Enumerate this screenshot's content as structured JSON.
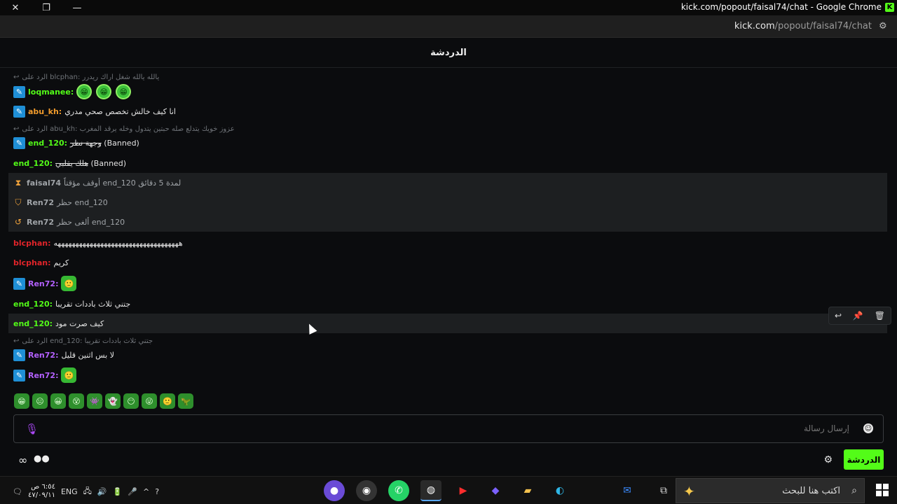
{
  "window": {
    "title": "kick.com/popout/faisal74/chat - Google Chrome",
    "close_icon": "close-icon",
    "restore_icon": "restore-icon",
    "minimize_icon": "minimize-icon"
  },
  "url": {
    "domain": "kick.com",
    "path": "/popout/faisal74/chat"
  },
  "header": {
    "title": "الدردشة"
  },
  "messages": [
    {
      "type": "reply",
      "text": "الرد على blcphan: يالله يالله شغل اراك ريدرر"
    },
    {
      "type": "chat",
      "user": "loqmanee",
      "color": "green",
      "badge": true,
      "text": "",
      "emotes": [
        "😁",
        "😁",
        "😁"
      ]
    },
    {
      "type": "chat",
      "user": "abu_kh",
      "color": "orange",
      "badge": true,
      "text": "انا كيف خالش تخصص صحي مدري"
    },
    {
      "type": "reply",
      "text": "الرد على abu_kh: عزوز خويك يتدلع صله حبتين يتدول وخله يرقد المغرب"
    },
    {
      "type": "chat",
      "user": "end_120",
      "color": "green",
      "badge": true,
      "text": "وجهة نظر",
      "banned": "(Banned)"
    },
    {
      "type": "chat",
      "user": "end_120",
      "color": "green",
      "badge": false,
      "text": "هلك يقلبي",
      "banned": "(Banned)"
    },
    {
      "type": "mod",
      "user": "faisal74",
      "text": "أوقف مؤقتاً end_120 لمدة 5 دقائق"
    },
    {
      "type": "mod",
      "user": "Ren72",
      "text": "حظر end_120"
    },
    {
      "type": "mod",
      "user": "Ren72",
      "text": "ألغى حظر end_120"
    },
    {
      "type": "chat",
      "user": "blcphan",
      "color": "red",
      "badge": false,
      "text": "هههههههههههههههههههههههههههههههههههه"
    },
    {
      "type": "chat",
      "user": "blcphan",
      "color": "red",
      "badge": false,
      "text": "كريم"
    },
    {
      "type": "chat",
      "user": "Ren72",
      "color": "purple",
      "badge": true,
      "text": "",
      "emotes": [
        "🙂"
      ]
    },
    {
      "type": "chat",
      "user": "end_120",
      "color": "green",
      "badge": false,
      "text": "جتني ثلاث باددات تقريبا"
    },
    {
      "type": "chat",
      "user": "end_120",
      "color": "green",
      "badge": false,
      "text": "كيف صرت مود"
    },
    {
      "type": "reply",
      "text": "الرد على end_120: جتني ثلاث باددات تقريبا"
    },
    {
      "type": "chat",
      "user": "Ren72",
      "color": "purple",
      "badge": true,
      "text": "لا بس اثنين قليل"
    },
    {
      "type": "chat",
      "user": "Ren72",
      "color": "purple",
      "badge": true,
      "text": "",
      "emotes": [
        "🙂"
      ]
    }
  ],
  "message_actions": {
    "reply_icon": "reply-icon",
    "pin_icon": "pin-icon",
    "delete_icon": "delete-icon"
  },
  "emote_bar": [
    "😁",
    "😐",
    "😀",
    "😵",
    "👾",
    "👻",
    "😶",
    "😜",
    "🙂",
    "🦖"
  ],
  "input": {
    "placeholder": "إرسال رسالة"
  },
  "footer": {
    "send_label": "الدردشة"
  },
  "taskbar": {
    "time": "٦:٥٤ ص",
    "date": "٤٧/٠٩/١١",
    "lang": "ENG",
    "search_placeholder": "اكتب هنا للبحث"
  },
  "colors": {
    "accent": "#53fc18",
    "background": "#0b0c0e",
    "badge_blue": "#1f8fd6"
  }
}
